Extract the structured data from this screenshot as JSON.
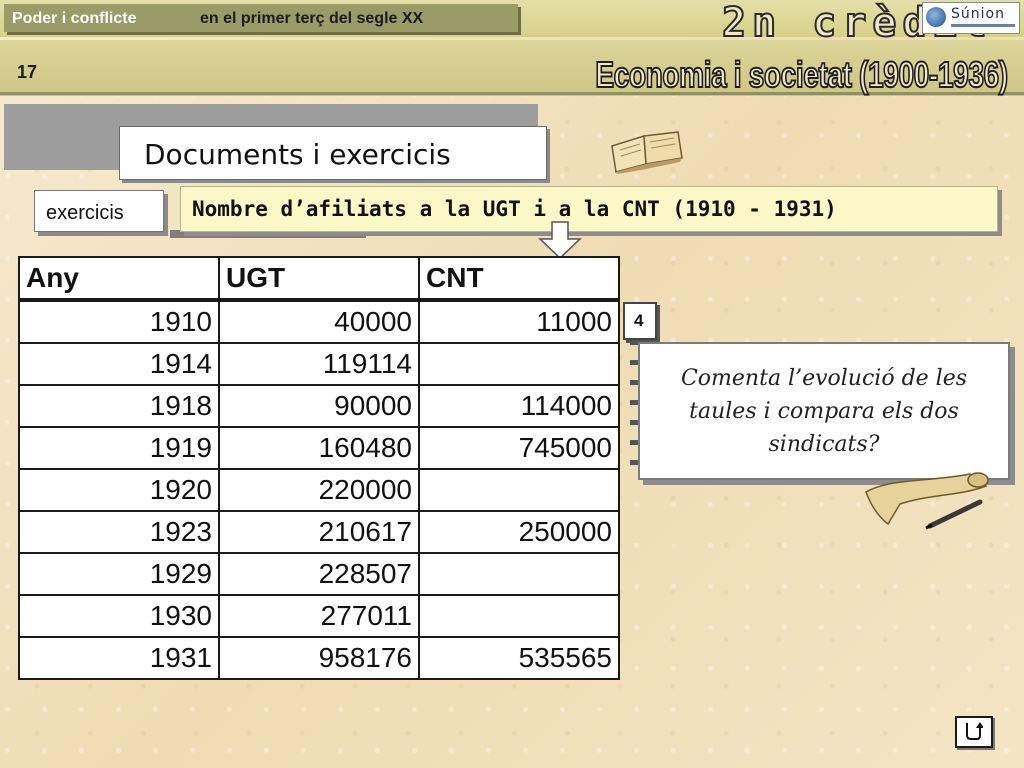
{
  "header": {
    "section_part1": "Poder i conflicte",
    "section_part2": "en el primer terç del segle XX",
    "credit": "2n crèdit",
    "logo_text": "Súnion"
  },
  "page": {
    "number": "17",
    "title": "Economia i societat (1900-1936)"
  },
  "documents_label": "Documents i exercicis",
  "exercise_tab": "exercicis",
  "table_title": "Nombre d’afiliats a la UGT i a la CNT (1910 - 1931)",
  "table": {
    "headers": [
      "Any",
      "UGT",
      "CNT"
    ],
    "rows": [
      [
        "1910",
        "40000",
        "11000"
      ],
      [
        "1914",
        "119114",
        ""
      ],
      [
        "1918",
        "90000",
        "114000"
      ],
      [
        "1919",
        "160480",
        "745000"
      ],
      [
        "1920",
        "220000",
        ""
      ],
      [
        "1923",
        "210617",
        "250000"
      ],
      [
        "1929",
        "228507",
        ""
      ],
      [
        "1930",
        "277011",
        ""
      ],
      [
        "1931",
        "958176",
        "535565"
      ]
    ]
  },
  "question": {
    "number": "4",
    "text": "Comenta l’evolució de les taules i compara els dos sindicats?"
  },
  "icons": {
    "book": "open-book-icon",
    "scroll": "parchment-scroll-icon",
    "arrow": "down-arrow-icon",
    "home": "return-arrow-icon"
  }
}
